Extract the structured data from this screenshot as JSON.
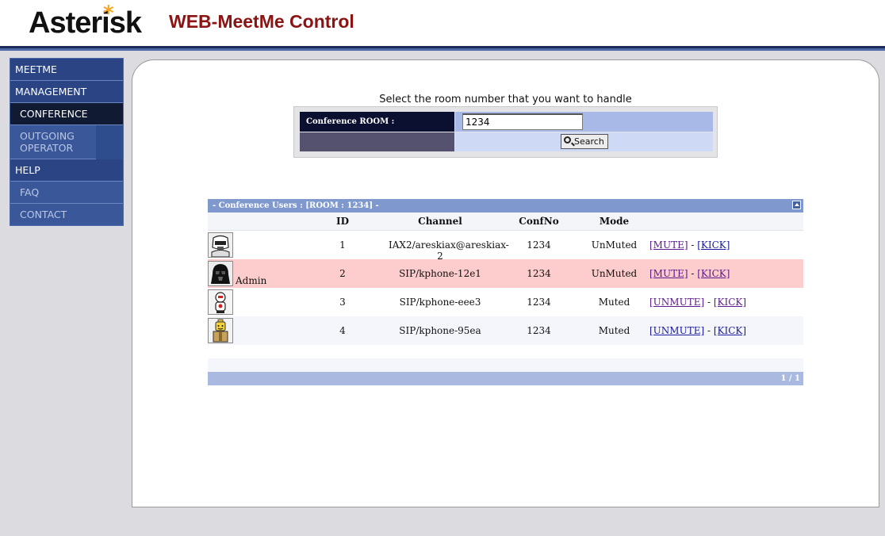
{
  "header": {
    "logo_text": "Asterisk",
    "title": "WEB-MeetMe Control",
    "colors": {
      "title": "#8b1313",
      "logo_star": "#f5a623",
      "bar": "#1b2a56"
    }
  },
  "sidebar": {
    "items": [
      {
        "label": "MEETME",
        "kind": "top"
      },
      {
        "label": "MANAGEMENT",
        "kind": "top"
      },
      {
        "label": "CONFERENCE",
        "kind": "active"
      },
      {
        "label": "OUTGOING OPERATOR",
        "kind": "sub"
      },
      {
        "label": "HELP",
        "kind": "top"
      },
      {
        "label": "FAQ",
        "kind": "sub"
      },
      {
        "label": "CONTACT",
        "kind": "sub"
      }
    ]
  },
  "room_form": {
    "prompt": "Select the room number that you want to handle",
    "label": "Conference ROOM :",
    "value": "1234",
    "search_button": "Search"
  },
  "users_grid": {
    "title": "- Conference Users : [ROOM : 1234] -",
    "columns": {
      "id": "ID",
      "channel": "Channel",
      "confno": "ConfNo",
      "mode": "Mode"
    },
    "rows": [
      {
        "avatar": "stormtrooper-icon",
        "name": "",
        "id": "1",
        "channel": "IAX2/areskiax@areskiax-2",
        "confno": "1234",
        "mode": "UnMuted",
        "action": "[MUTE]",
        "kick": "[KICK]"
      },
      {
        "avatar": "darth-vader-icon",
        "name": "Admin",
        "id": "2",
        "channel": "SIP/kphone-12e1",
        "confno": "1234",
        "mode": "UnMuted",
        "action": "[MUTE]",
        "kick": "[KICK]"
      },
      {
        "avatar": "robot-icon",
        "name": "",
        "id": "3",
        "channel": "SIP/kphone-eee3",
        "confno": "1234",
        "mode": "Muted",
        "action": "[UNMUTE]",
        "kick": "[KICK]"
      },
      {
        "avatar": "lego-figure-icon",
        "name": "",
        "id": "4",
        "channel": "SIP/kphone-95ea",
        "confno": "1234",
        "mode": "Muted",
        "action": "[UNMUTE]",
        "kick": "[KICK]"
      }
    ],
    "pagination": "1 / 1"
  }
}
